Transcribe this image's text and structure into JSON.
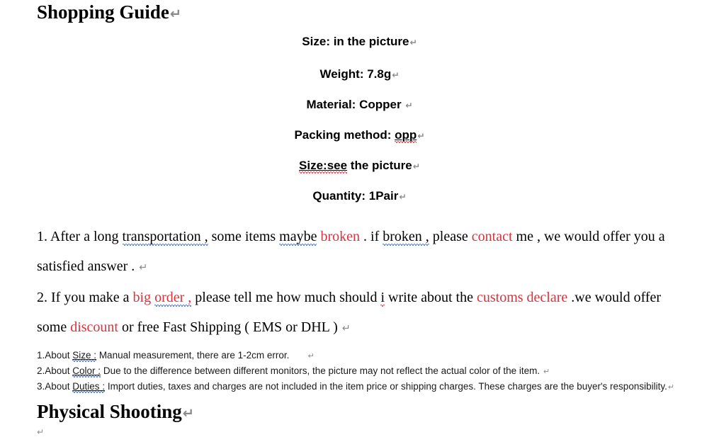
{
  "document": {
    "heading_top": "Shopping Guide",
    "heading_bottom": "Physical Shooting",
    "paragraph_mark": "↵",
    "accent_red": "#d4343c",
    "spellcheck_red": "#e0282e",
    "grammarcheck_blue": "#3a62c4",
    "specs": [
      {
        "label": "Size: in the picture"
      },
      {
        "label": "Weight: 7.8g"
      },
      {
        "label": "Material: Copper "
      },
      {
        "label_prefix": "Packing method: ",
        "label_flagged": "opp"
      },
      {
        "label_flagged": "Size:see",
        "label_suffix": " the picture"
      },
      {
        "label": "Quantity: 1Pair"
      }
    ],
    "terms": [
      {
        "number": "1.",
        "segments": [
          {
            "text": " After a long "
          },
          {
            "text": "transportation ,",
            "mark": "grammar"
          },
          {
            "text": " some items "
          },
          {
            "text": "maybe",
            "mark": "grammar"
          },
          {
            "text": " "
          },
          {
            "text": "broken",
            "color": "red"
          },
          {
            "text": " . if "
          },
          {
            "text": "broken ,",
            "mark": "grammar"
          },
          {
            "text": " please "
          },
          {
            "text": "contact",
            "color": "red"
          },
          {
            "text": " me , we would offer you a satisfied answer . "
          }
        ]
      },
      {
        "number": "2.",
        "segments": [
          {
            "text": " If you make a "
          },
          {
            "text": "big ",
            "color": "red"
          },
          {
            "text": "order ,",
            "color": "red",
            "mark": "grammar"
          },
          {
            "text": " please tell me how much should "
          },
          {
            "text": "i",
            "mark": "spelling"
          },
          {
            "text": " write about the "
          },
          {
            "text": "customs declare",
            "color": "red"
          },
          {
            "text": " .we would offer some "
          },
          {
            "text": "discount",
            "color": "red"
          },
          {
            "text": " or free Fast Shipping ( EMS or DHL ) "
          }
        ]
      }
    ],
    "notes": [
      {
        "number": "1.About ",
        "flagged": "Size :",
        "text": " Manual measurement, there are 1-2cm error.",
        "has_mark": true
      },
      {
        "number": "2.About ",
        "flagged": "Color :",
        "text": " Due to the difference between different monitors, the picture may not reflect the actual color of the item. ",
        "has_mark": true
      },
      {
        "number": "3.About ",
        "flagged": "Duties :",
        "text": " Import duties, taxes and charges are not included in the item price or shipping charges. These charges are the buyer's responsibility.",
        "has_mark": true
      }
    ]
  }
}
